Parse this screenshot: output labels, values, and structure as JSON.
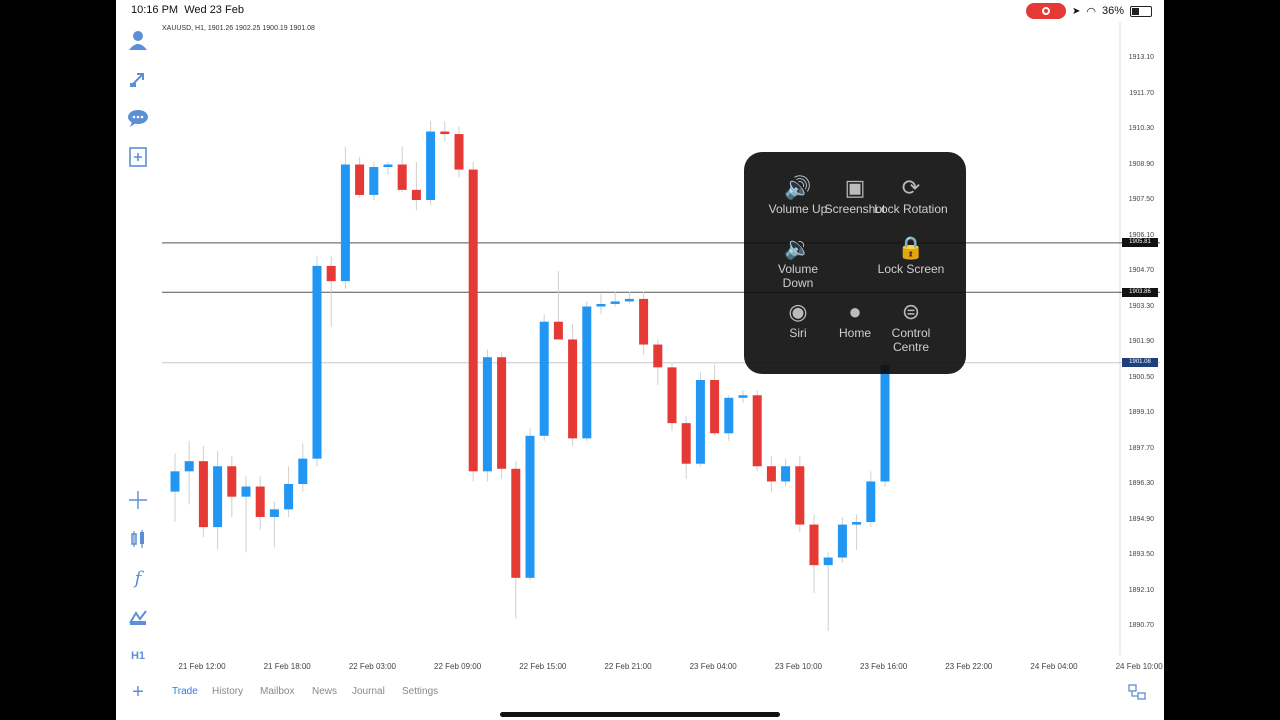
{
  "status_bar": {
    "time": "10:16 PM",
    "date": "Wed 23 Feb",
    "battery": "36%"
  },
  "chart": {
    "header": "XAUUSD, H1, 1901.26 1902.25 1900.19 1901.08",
    "price_tags": [
      "1905.81",
      "1903.86",
      "1901.08"
    ],
    "price_tag_colors": [
      "#111111",
      "#111111",
      "#1f3f7a"
    ]
  },
  "chart_data": {
    "type": "candlestick",
    "symbol": "XAUUSD",
    "timeframe": "H1",
    "ylim": [
      1888.5,
      1914.5
    ],
    "y_ticks": [
      "1913.10",
      "1911.70",
      "1910.30",
      "1908.90",
      "1907.50",
      "1906.10",
      "1904.70",
      "1903.30",
      "1901.90",
      "1900.50",
      "1899.10",
      "1897.70",
      "1896.30",
      "1894.90",
      "1893.50",
      "1892.10",
      "1890.70"
    ],
    "x_ticks": [
      "21 Feb 12:00",
      "21 Feb 18:00",
      "22 Feb 03:00",
      "22 Feb 09:00",
      "22 Feb 15:00",
      "22 Feb 21:00",
      "23 Feb 04:00",
      "23 Feb 10:00",
      "23 Feb 16:00",
      "23 Feb 22:00",
      "24 Feb 04:00",
      "24 Feb 10:00"
    ],
    "horizontal_lines": [
      1905.81,
      1903.86,
      1901.08
    ],
    "up_color": "#2196f3",
    "down_color": "#e53935",
    "candles": [
      {
        "o": 1896.0,
        "h": 1897.5,
        "l": 1894.8,
        "c": 1896.8
      },
      {
        "o": 1896.8,
        "h": 1898.0,
        "l": 1895.5,
        "c": 1897.2
      },
      {
        "o": 1897.2,
        "h": 1897.8,
        "l": 1894.2,
        "c": 1894.6
      },
      {
        "o": 1894.6,
        "h": 1897.6,
        "l": 1893.7,
        "c": 1897.0
      },
      {
        "o": 1897.0,
        "h": 1897.4,
        "l": 1895.0,
        "c": 1895.8
      },
      {
        "o": 1895.8,
        "h": 1896.6,
        "l": 1893.6,
        "c": 1896.2
      },
      {
        "o": 1896.2,
        "h": 1896.6,
        "l": 1894.5,
        "c": 1895.0
      },
      {
        "o": 1895.0,
        "h": 1895.6,
        "l": 1893.8,
        "c": 1895.3
      },
      {
        "o": 1895.3,
        "h": 1897.0,
        "l": 1895.0,
        "c": 1896.3
      },
      {
        "o": 1896.3,
        "h": 1897.9,
        "l": 1896.0,
        "c": 1897.3
      },
      {
        "o": 1897.3,
        "h": 1905.3,
        "l": 1897.0,
        "c": 1904.9
      },
      {
        "o": 1904.9,
        "h": 1905.3,
        "l": 1902.5,
        "c": 1904.3
      },
      {
        "o": 1904.3,
        "h": 1909.6,
        "l": 1904.0,
        "c": 1908.9
      },
      {
        "o": 1908.9,
        "h": 1909.2,
        "l": 1907.6,
        "c": 1907.7
      },
      {
        "o": 1907.7,
        "h": 1909.0,
        "l": 1907.5,
        "c": 1908.8
      },
      {
        "o": 1908.8,
        "h": 1909.0,
        "l": 1908.5,
        "c": 1908.9
      },
      {
        "o": 1908.9,
        "h": 1909.6,
        "l": 1907.8,
        "c": 1907.9
      },
      {
        "o": 1907.9,
        "h": 1909.0,
        "l": 1907.1,
        "c": 1907.5
      },
      {
        "o": 1907.5,
        "h": 1910.6,
        "l": 1907.3,
        "c": 1910.2
      },
      {
        "o": 1910.2,
        "h": 1910.6,
        "l": 1909.8,
        "c": 1910.1
      },
      {
        "o": 1910.1,
        "h": 1910.4,
        "l": 1908.4,
        "c": 1908.7
      },
      {
        "o": 1908.7,
        "h": 1909.0,
        "l": 1896.4,
        "c": 1896.8
      },
      {
        "o": 1896.8,
        "h": 1901.6,
        "l": 1896.4,
        "c": 1901.3
      },
      {
        "o": 1901.3,
        "h": 1901.5,
        "l": 1896.5,
        "c": 1896.9
      },
      {
        "o": 1896.9,
        "h": 1897.2,
        "l": 1891.0,
        "c": 1892.6
      },
      {
        "o": 1892.6,
        "h": 1898.5,
        "l": 1892.5,
        "c": 1898.2
      },
      {
        "o": 1898.2,
        "h": 1903.0,
        "l": 1898.0,
        "c": 1902.7
      },
      {
        "o": 1902.7,
        "h": 1904.7,
        "l": 1902.0,
        "c": 1902.0
      },
      {
        "o": 1902.0,
        "h": 1902.6,
        "l": 1897.8,
        "c": 1898.1
      },
      {
        "o": 1898.1,
        "h": 1903.5,
        "l": 1898.0,
        "c": 1903.3
      },
      {
        "o": 1903.3,
        "h": 1903.8,
        "l": 1903.0,
        "c": 1903.4
      },
      {
        "o": 1903.4,
        "h": 1903.9,
        "l": 1903.3,
        "c": 1903.5
      },
      {
        "o": 1903.5,
        "h": 1903.9,
        "l": 1903.4,
        "c": 1903.6
      },
      {
        "o": 1903.6,
        "h": 1903.9,
        "l": 1901.4,
        "c": 1901.8
      },
      {
        "o": 1901.8,
        "h": 1902.0,
        "l": 1900.2,
        "c": 1900.9
      },
      {
        "o": 1900.9,
        "h": 1901.1,
        "l": 1898.4,
        "c": 1898.7
      },
      {
        "o": 1898.7,
        "h": 1899.0,
        "l": 1896.5,
        "c": 1897.1
      },
      {
        "o": 1897.1,
        "h": 1900.7,
        "l": 1897.0,
        "c": 1900.4
      },
      {
        "o": 1900.4,
        "h": 1901.0,
        "l": 1898.2,
        "c": 1898.3
      },
      {
        "o": 1898.3,
        "h": 1899.8,
        "l": 1898.0,
        "c": 1899.7
      },
      {
        "o": 1899.7,
        "h": 1900.0,
        "l": 1899.5,
        "c": 1899.8
      },
      {
        "o": 1899.8,
        "h": 1900.0,
        "l": 1896.8,
        "c": 1897.0
      },
      {
        "o": 1897.0,
        "h": 1897.4,
        "l": 1896.0,
        "c": 1896.4
      },
      {
        "o": 1896.4,
        "h": 1897.3,
        "l": 1896.2,
        "c": 1897.0
      },
      {
        "o": 1897.0,
        "h": 1897.4,
        "l": 1894.4,
        "c": 1894.7
      },
      {
        "o": 1894.7,
        "h": 1895.1,
        "l": 1892.0,
        "c": 1893.1
      },
      {
        "o": 1893.1,
        "h": 1893.6,
        "l": 1890.5,
        "c": 1893.4
      },
      {
        "o": 1893.4,
        "h": 1895.0,
        "l": 1893.2,
        "c": 1894.7
      },
      {
        "o": 1894.7,
        "h": 1895.1,
        "l": 1893.7,
        "c": 1894.8
      },
      {
        "o": 1894.8,
        "h": 1896.8,
        "l": 1894.6,
        "c": 1896.4
      },
      {
        "o": 1896.4,
        "h": 1901.2,
        "l": 1896.2,
        "c": 1901.0
      }
    ]
  },
  "toolbar": {
    "top_icons": [
      "account-icon",
      "trade-arrow-icon",
      "chat-icon",
      "new-order-icon"
    ],
    "bottom_icons": [
      "crosshair-icon",
      "indicator-icon",
      "function-icon",
      "objects-icon"
    ],
    "timeframe": "H1",
    "add_icon": "plus-icon"
  },
  "bottom_tabs": [
    "Trade",
    "History",
    "Mailbox",
    "News",
    "Journal",
    "Settings"
  ],
  "assistive_touch": {
    "items": [
      {
        "label": "Volume Up",
        "icon": "volume-up-icon"
      },
      {
        "label": "Screenshot",
        "icon": "screenshot-icon"
      },
      {
        "label": "Lock Rotation",
        "icon": "lock-rotation-icon"
      },
      {
        "label": "Volume Down",
        "icon": "volume-down-icon"
      },
      {
        "label": "Lock Screen",
        "icon": "lock-screen-icon"
      },
      {
        "label": "Siri",
        "icon": "siri-icon"
      },
      {
        "label": "Home",
        "icon": "home-icon"
      },
      {
        "label": "Control Centre",
        "icon": "control-centre-icon"
      }
    ]
  }
}
